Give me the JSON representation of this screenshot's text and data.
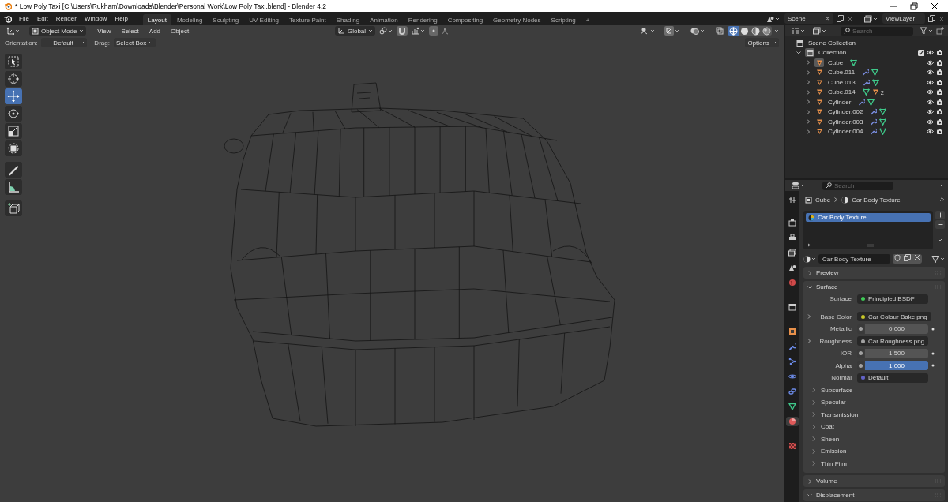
{
  "window": {
    "title": "* Low Poly Taxi [C:\\Users\\Rukham\\Downloads\\Blender\\Personal Work\\Low Poly Taxi.blend] - Blender 4.2"
  },
  "menu": [
    "File",
    "Edit",
    "Render",
    "Window",
    "Help"
  ],
  "workspaces": [
    {
      "label": "Layout",
      "selected": true
    },
    {
      "label": "Modeling",
      "selected": false
    },
    {
      "label": "Sculpting",
      "selected": false
    },
    {
      "label": "UV Editing",
      "selected": false
    },
    {
      "label": "Texture Paint",
      "selected": false
    },
    {
      "label": "Shading",
      "selected": false
    },
    {
      "label": "Animation",
      "selected": false
    },
    {
      "label": "Rendering",
      "selected": false
    },
    {
      "label": "Compositing",
      "selected": false
    },
    {
      "label": "Geometry Nodes",
      "selected": false
    },
    {
      "label": "Scripting",
      "selected": false
    }
  ],
  "add_workspace": "+",
  "scene": "Scene",
  "view_layer": "ViewLayer",
  "viewport": {
    "mode": "Object Mode",
    "menus": [
      "View",
      "Select",
      "Add",
      "Object"
    ],
    "transform_orientation": "Global",
    "orientation_label": "Orientation:",
    "orientation": "Default",
    "drag_label": "Drag:",
    "drag": "Select Box",
    "options": "Options",
    "snap": true,
    "proportional": true,
    "gizmos": true,
    "shading": [
      {
        "kind": "wireframe",
        "selected": true
      },
      {
        "kind": "solid",
        "selected": false
      },
      {
        "kind": "material",
        "selected": false
      },
      {
        "kind": "rendered",
        "selected": false
      }
    ],
    "tools": [
      {
        "kind": "select",
        "selected": false
      },
      {
        "kind": "cursor",
        "selected": false
      },
      {
        "kind": "move",
        "selected": true
      },
      {
        "kind": "rotate",
        "selected": false
      },
      {
        "kind": "scale",
        "selected": false
      },
      {
        "kind": "transform",
        "selected": false
      },
      {
        "kind": "annotate",
        "selected": false
      },
      {
        "kind": "measure",
        "selected": false
      },
      {
        "kind": "add_cube",
        "selected": false
      }
    ]
  },
  "outliner": {
    "search": {
      "placeholder": "Search"
    },
    "root": "Scene Collection",
    "collection": {
      "name": "Collection",
      "expanded": true,
      "checked": true,
      "children": [
        {
          "name": "Cube",
          "selected": true,
          "expanded": false,
          "badges": [
            {
              "kind": "mesh"
            }
          ]
        },
        {
          "name": "Cube.011",
          "selected": false,
          "expanded": false,
          "badges": [
            {
              "kind": "modifier"
            },
            {
              "kind": "mesh"
            }
          ]
        },
        {
          "name": "Cube.013",
          "selected": false,
          "expanded": false,
          "badges": [
            {
              "kind": "modifier"
            },
            {
              "kind": "mesh"
            }
          ]
        },
        {
          "name": "Cube.014",
          "selected": false,
          "expanded": false,
          "badges": [
            {
              "kind": "mesh"
            },
            {
              "kind": "object",
              "count": "2"
            }
          ]
        },
        {
          "name": "Cylinder",
          "selected": false,
          "expanded": false,
          "badges": [
            {
              "kind": "modifier"
            },
            {
              "kind": "mesh"
            }
          ]
        },
        {
          "name": "Cylinder.002",
          "selected": false,
          "expanded": false,
          "badges": [
            {
              "kind": "modifier"
            },
            {
              "kind": "mesh"
            }
          ]
        },
        {
          "name": "Cylinder.003",
          "selected": false,
          "expanded": false,
          "badges": [
            {
              "kind": "modifier"
            },
            {
              "kind": "mesh"
            }
          ]
        },
        {
          "name": "Cylinder.004",
          "selected": false,
          "expanded": false,
          "badges": [
            {
              "kind": "modifier"
            },
            {
              "kind": "mesh"
            }
          ]
        }
      ]
    }
  },
  "properties": {
    "search": {
      "placeholder": "Search"
    },
    "tabs": [
      {
        "kind": "tool",
        "selected": false
      },
      {
        "kind": "render",
        "selected": false
      },
      {
        "kind": "output",
        "selected": false
      },
      {
        "kind": "view_layer",
        "selected": false
      },
      {
        "kind": "scene",
        "selected": false
      },
      {
        "kind": "world",
        "selected": false
      },
      {
        "kind": "collection",
        "selected": false
      },
      {
        "kind": "object",
        "selected": false
      },
      {
        "kind": "modifiers",
        "selected": false
      },
      {
        "kind": "particles",
        "selected": false
      },
      {
        "kind": "physics",
        "selected": false
      },
      {
        "kind": "constraints",
        "selected": false
      },
      {
        "kind": "data",
        "selected": false
      },
      {
        "kind": "material",
        "selected": true
      },
      {
        "kind": "texture",
        "selected": false
      }
    ],
    "breadcrumb": [
      "Cube",
      "Car Body Texture"
    ],
    "material_slots": [
      {
        "name": "Car Body Texture",
        "selected": true
      }
    ],
    "material": "Car Body Texture",
    "panels": [
      {
        "title": "Preview",
        "expanded": false
      },
      {
        "title": "Surface",
        "expanded": true,
        "rows": [
          {
            "kind": "link",
            "label": "Surface",
            "value": "Principled BSDF",
            "color": "#3fc956",
            "highlighted": false
          },
          {
            "kind": "link",
            "label": "Base Color",
            "value": "Car Colour Bake.png",
            "color": "#c7c729",
            "expanded": false,
            "highlighted": false
          },
          {
            "kind": "number",
            "label": "Metallic",
            "value": "0.000",
            "color": "#a1a1a1",
            "highlighted": false
          },
          {
            "kind": "link",
            "label": "Roughness",
            "value": "Car Roughness.png",
            "color": "#a1a1a1",
            "expanded": false,
            "highlighted": false
          },
          {
            "kind": "number",
            "label": "IOR",
            "value": "1.500",
            "color": "#a1a1a1",
            "highlighted": false
          },
          {
            "kind": "number",
            "label": "Alpha",
            "value": "1.000",
            "color": "#a1a1a1",
            "highlighted": true
          },
          {
            "kind": "link",
            "label": "Normal",
            "value": "Default",
            "color": "#6363c7",
            "highlighted": false
          }
        ],
        "subpanels": [
          {
            "title": "Subsurface",
            "expanded": false
          },
          {
            "title": "Specular",
            "expanded": false
          },
          {
            "title": "Transmission",
            "expanded": false
          },
          {
            "title": "Coat",
            "expanded": false
          },
          {
            "title": "Sheen",
            "expanded": false
          },
          {
            "title": "Emission",
            "expanded": false
          },
          {
            "title": "Thin Film",
            "expanded": false
          }
        ]
      },
      {
        "title": "Volume",
        "expanded": false
      },
      {
        "title": "Displacement",
        "expanded": true
      }
    ]
  }
}
